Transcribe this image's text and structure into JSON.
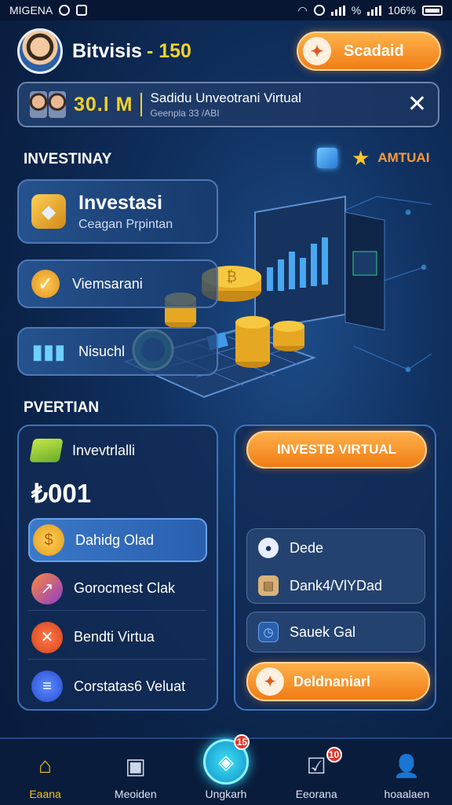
{
  "status_bar": {
    "carrier": "MIGENA",
    "battery": "106%"
  },
  "header": {
    "username": "Bitvisis",
    "score": "- 150",
    "button_label": "Scadaid"
  },
  "banner": {
    "amount": "30.l M",
    "title": "Sadidu Unveotrani Virtual",
    "subtitle": "Geenpla 33 /ABI"
  },
  "section1": {
    "title": "INVESTINAY",
    "mutual_label": "AMTUAI"
  },
  "menu": {
    "invest_title": "Investasi",
    "invest_subtitle": "Ceagan Prpintan",
    "item2": "Viemsarani",
    "item3": "Nisuchl"
  },
  "section2": {
    "title": "PVERTIAN"
  },
  "left_panel": {
    "header_label": "Invevtrlalli",
    "balance": "₺001",
    "items": [
      "Dahidg Olad",
      "Gorocmest Clak",
      "Bendti Virtua",
      "Corstatas6 Veluat"
    ]
  },
  "right_panel": {
    "invest_button": "INVESTB VIRTUAL",
    "box1_row1": "Dede",
    "box1_row2": "Dank4/VlYDad",
    "box2_row1": "Sauek Gal",
    "bottom_button": "Deldnaniarl"
  },
  "bottom_nav": [
    {
      "label": "Eaana"
    },
    {
      "label": "Meoiden"
    },
    {
      "label": "Ungkarh",
      "badge": "15"
    },
    {
      "label": "Eeorana",
      "badge": "10"
    },
    {
      "label": "hoaalaen"
    }
  ],
  "colors": {
    "accent_orange": "#f07e16",
    "accent_yellow": "#f3d32c",
    "bg_navy": "#0a2146"
  }
}
